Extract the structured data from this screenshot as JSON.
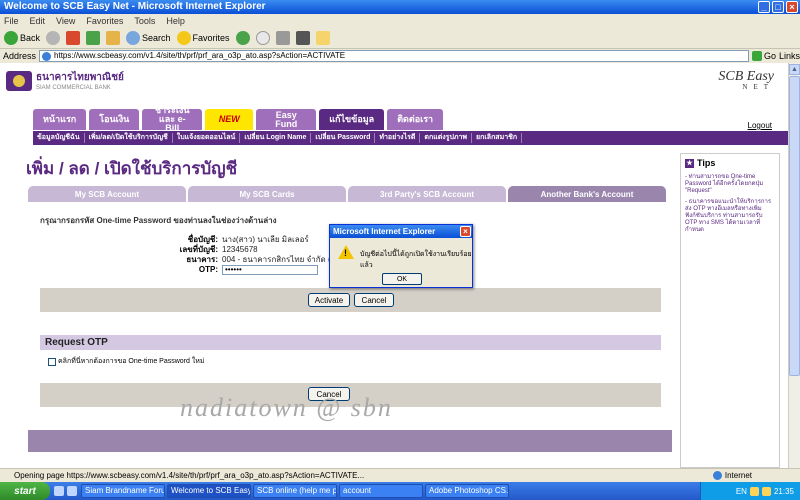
{
  "window": {
    "title": "Welcome to SCB Easy Net - Microsoft Internet Explorer"
  },
  "menu": [
    "File",
    "Edit",
    "View",
    "Favorites",
    "Tools",
    "Help"
  ],
  "toolbar": {
    "back": "Back",
    "search": "Search",
    "favorites": "Favorites"
  },
  "address": {
    "label": "Address",
    "url": "https://www.scbeasy.com/v1.4/site/th/prf/prf_ara_o3p_ato.asp?sAction=ACTIVATE",
    "go": "Go",
    "links": "Links"
  },
  "header": {
    "bank_name": "ธนาคารไทยพาณิชย์",
    "bank_sub": "SIAM COMMERCIAL BANK",
    "brand": "SCB Easy",
    "brand_sub": "NET",
    "logout": "Logout"
  },
  "main_nav": [
    {
      "label": "หน้าแรก"
    },
    {
      "label": "โอนเงิน"
    },
    {
      "label": "ชำระเงิน และ e-Bill"
    },
    {
      "label": "NEW"
    },
    {
      "label": "Easy Fund"
    },
    {
      "label": "แก้ไขข้อมูล"
    },
    {
      "label": "ติดต่อเรา"
    }
  ],
  "sub_nav": [
    "ข้อมูลบัญชีฉัน",
    "เพิ่ม/ลด/เปิดใช้บริการบัญชี",
    "ใบแจ้งยอดออนไลน์",
    "เปลี่ยน Login Name",
    "เปลี่ยน Password",
    "ทำอย่างไรดี",
    "ตกแต่งรูปภาพ",
    "ยกเลิกสมาชิก"
  ],
  "page": {
    "title": "เพิ่ม / ลด / เปิดใช้บริการบัญชี"
  },
  "account_tabs": [
    "My SCB Account",
    "My SCB Cards",
    "3rd Party's SCB Account",
    "Another Bank's Account"
  ],
  "form": {
    "instruction": "กรุณากรอกรหัส One-time Password ของท่านลงในช่องว่างด้านล่าง",
    "rows": [
      {
        "label": "ชื่อบัญชี:",
        "value": "นาง(สาว) นาเลีย มิลเลอร์"
      },
      {
        "label": "เลขที่บัญชี:",
        "value": "12345678"
      },
      {
        "label": "ธนาคาร:",
        "value": "004 - ธนาคารกสิกรไทย จำกัด (มหาชน)"
      }
    ],
    "otp_label": "OTP:",
    "otp_value": "••••••",
    "activate": "Activate",
    "cancel": "Cancel"
  },
  "request_otp": {
    "title": "Request OTP",
    "option": "คลิกที่นี่หากต้องการขอ One-time Password ใหม่",
    "cancel": "Cancel"
  },
  "watermark": "nadiatown @ sbn",
  "tips": {
    "title": "Tips",
    "items": [
      "- ท่านสามารถขอ One-time Password ได้อีกครั้งโดยกดปุ่ม \"Request\"",
      "- ธนาคารขอแนะนำให้บริการการส่ง OTP ทางอีเมลหรือทางเพิ่มฟังก์ชันบริการ ท่านสามารถรับ OTP ทาง SMS ได้ตามเวลาที่กำหนด"
    ]
  },
  "dialog": {
    "title": "Microsoft Internet Explorer",
    "message": "บัญชีต่อไปนี้ได้ถูกเปิดใช้งานเรียบร้อยแล้ว",
    "ok": "OK"
  },
  "status": {
    "text": "Opening page https://www.scbeasy.com/v1.4/site/th/prf/prf_ara_o3p_ato.asp?sAction=ACTIVATE...",
    "zone": "Internet"
  },
  "taskbar": {
    "start": "start",
    "tasks": [
      "Siam Brandname Foru...",
      "Welcome to SCB Easy...",
      "SCB online (help me p...",
      "account",
      "Adobe Photoshop CS..."
    ],
    "lang": "EN",
    "time": "21:35"
  }
}
